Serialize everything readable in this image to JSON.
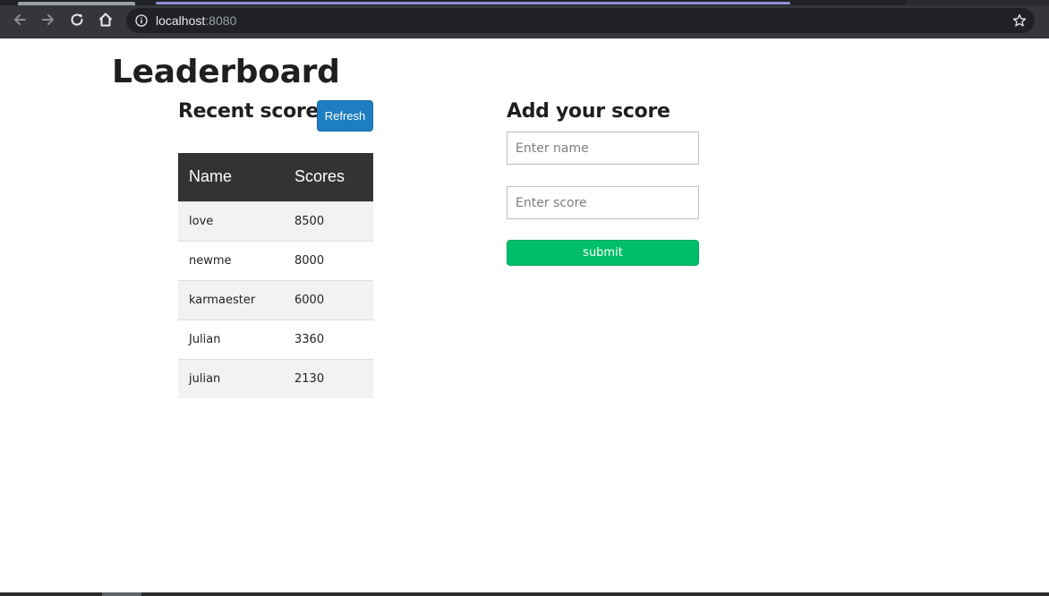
{
  "browser": {
    "url_host": "localhost",
    "url_port": ":8080",
    "icons": {
      "back": "arrow-left-icon",
      "forward": "arrow-right-icon",
      "reload": "reload-icon",
      "home": "home-icon",
      "info": "info-icon",
      "bookmark": "star-icon"
    }
  },
  "page": {
    "title": "Leaderboard"
  },
  "recent": {
    "title": "Recent scores",
    "refresh_label": "Refresh",
    "columns": [
      "Name",
      "Scores"
    ],
    "rows": [
      {
        "name": "love",
        "score": "8500"
      },
      {
        "name": "newme",
        "score": "8000"
      },
      {
        "name": "karmaester",
        "score": "6000"
      },
      {
        "name": "Julian",
        "score": "3360"
      },
      {
        "name": "julian",
        "score": "2130"
      }
    ]
  },
  "add": {
    "title": "Add your score",
    "name_placeholder": "Enter name",
    "name_value": "",
    "score_placeholder": "Enter score",
    "score_value": "",
    "submit_label": "submit"
  },
  "colors": {
    "refresh_button": "#1d7ec1",
    "submit_button": "#00bf6a",
    "table_header": "#333333",
    "table_stripe": "#f2f2f2"
  }
}
